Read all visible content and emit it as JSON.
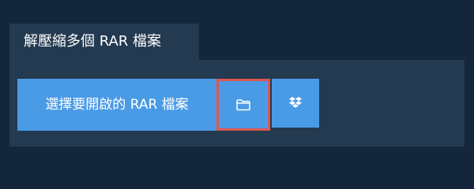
{
  "tab": {
    "label": "解壓縮多個 RAR 檔案"
  },
  "actions": {
    "open_label": "選擇要開啟的 RAR 檔案",
    "folder_icon": "folder-icon",
    "dropbox_icon": "dropbox-icon"
  },
  "colors": {
    "background": "#13263b",
    "panel": "#233a51",
    "button": "#4a9be6",
    "highlight": "#e0564f"
  }
}
